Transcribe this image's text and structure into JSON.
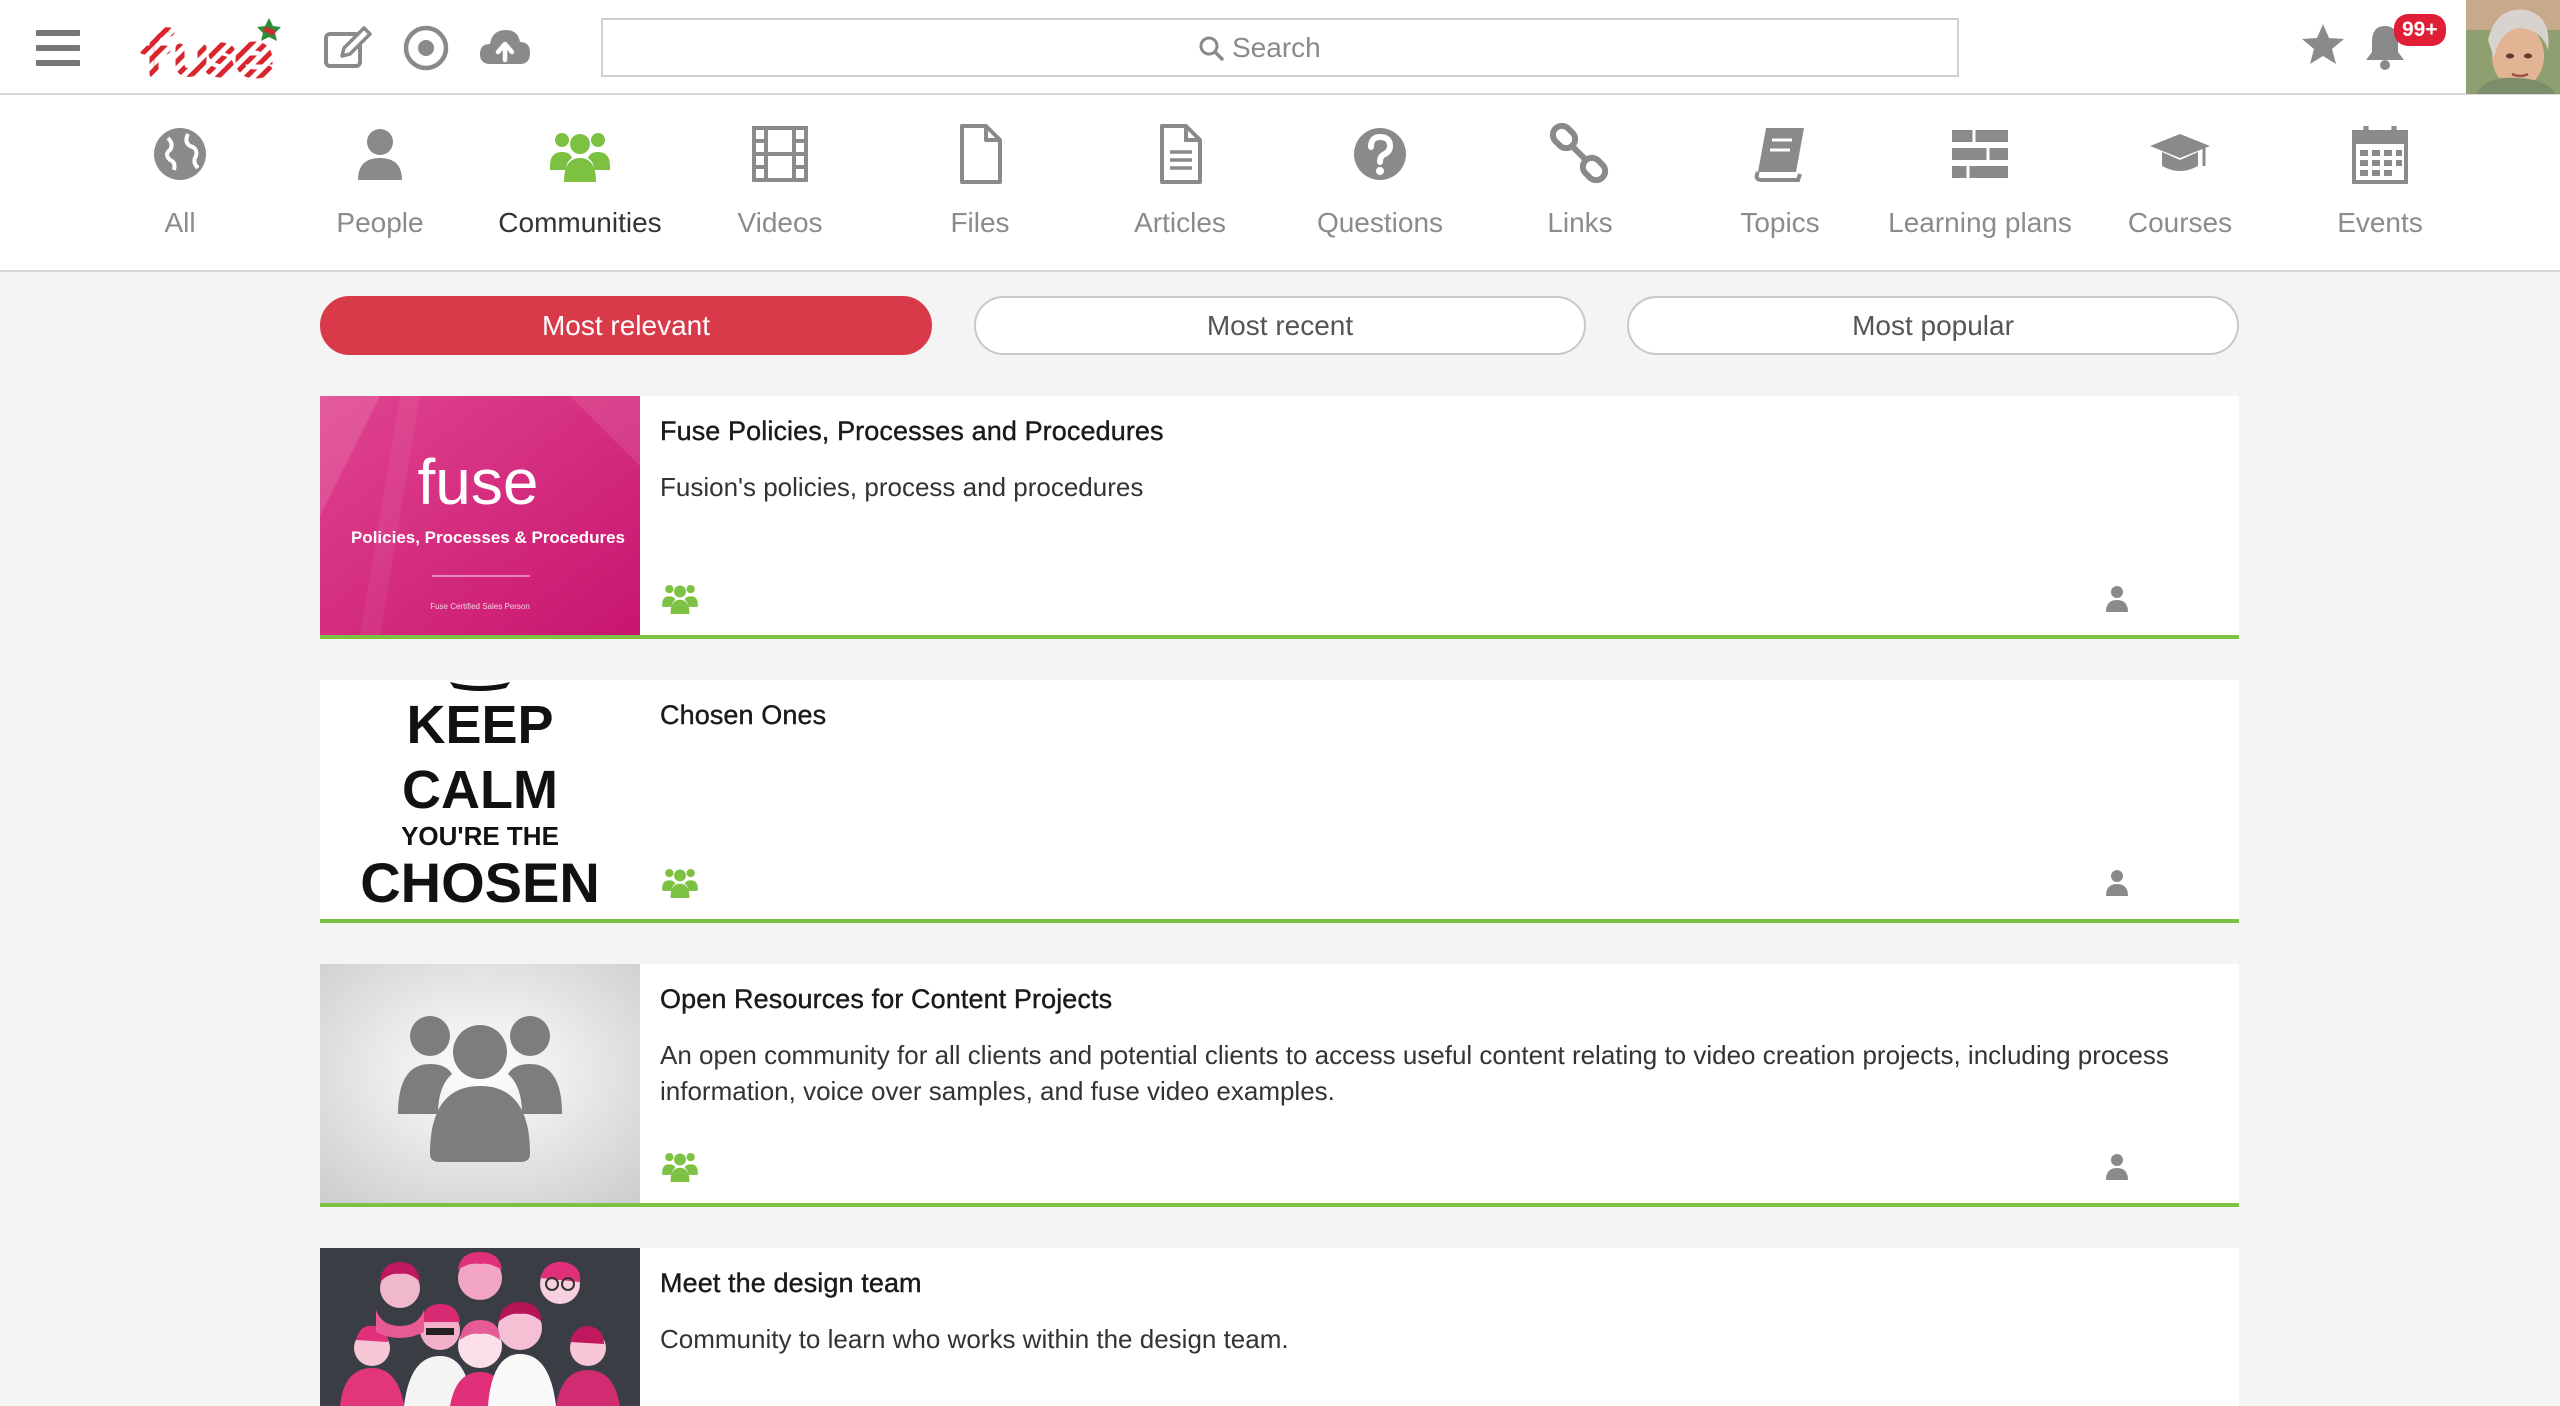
{
  "header": {
    "logo_text": "fuse",
    "search_placeholder": "Search",
    "notifications_badge": "99+"
  },
  "categories": [
    {
      "label": "All",
      "icon": "globe-icon"
    },
    {
      "label": "People",
      "icon": "person-icon"
    },
    {
      "label": "Communities",
      "icon": "group-icon",
      "active": true
    },
    {
      "label": "Videos",
      "icon": "film-icon"
    },
    {
      "label": "Files",
      "icon": "file-icon"
    },
    {
      "label": "Articles",
      "icon": "article-icon"
    },
    {
      "label": "Questions",
      "icon": "question-icon"
    },
    {
      "label": "Links",
      "icon": "link-icon"
    },
    {
      "label": "Topics",
      "icon": "book-icon"
    },
    {
      "label": "Learning plans",
      "icon": "learning-plan-icon"
    },
    {
      "label": "Courses",
      "icon": "graduation-cap-icon"
    },
    {
      "label": "Events",
      "icon": "calendar-icon"
    }
  ],
  "sort_tabs": [
    {
      "label": "Most relevant",
      "active": true
    },
    {
      "label": "Most recent",
      "active": false
    },
    {
      "label": "Most popular",
      "active": false
    }
  ],
  "communities": [
    {
      "title": "Fuse Policies, Processes and Procedures",
      "description": "Fusion's policies, process and procedures",
      "thumb": {
        "brand": "fuse",
        "subtitle": "Policies, Processes & Procedures",
        "footer": "Fuse Certified Sales Person"
      }
    },
    {
      "title": "Chosen Ones",
      "description": "",
      "thumb": {
        "line1": "KEEP",
        "line2": "CALM",
        "line3": "YOU'RE THE",
        "line4": "CHOSEN"
      }
    },
    {
      "title": "Open Resources for Content Projects",
      "description": "An open community for all clients and potential clients to access useful content relating to video creation projects, including process information, voice over samples, and fuse video examples.",
      "thumb": {}
    },
    {
      "title": "Meet the design team",
      "description": "Community to learn who works within the design team.",
      "thumb": {}
    }
  ],
  "colors": {
    "accent_red": "#d83a4a",
    "brand_green": "#7cc142",
    "icon_grey": "#8a8a8a",
    "badge_red": "#e01f37"
  }
}
